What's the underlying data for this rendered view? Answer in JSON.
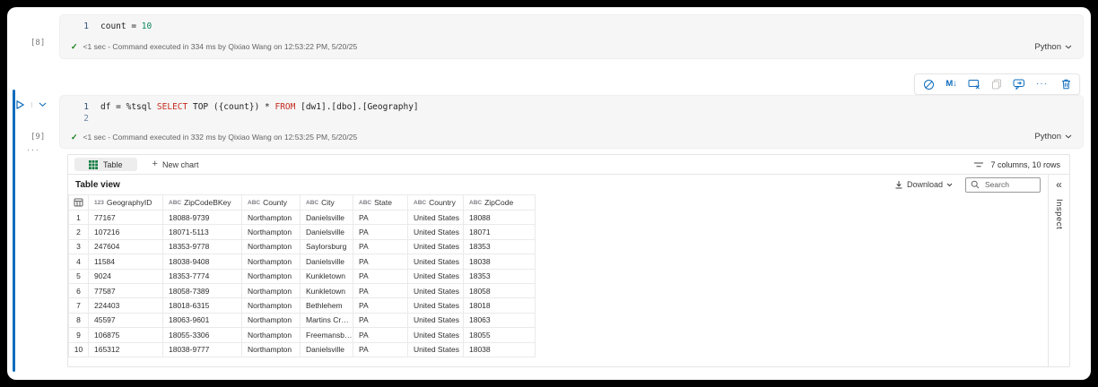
{
  "colors": {
    "accent_blue": "#0f6cbd",
    "success_green": "#0e7a0e",
    "keyword_red": "#c42b1c",
    "number_green": "#098658",
    "table_icon_green": "#107c41"
  },
  "glyphs": {
    "check": "✓",
    "markdown": "M↓",
    "more_menu": "···",
    "cell_more": "···",
    "plus": "+",
    "collapse": "«"
  },
  "cell1": {
    "exec_count": "[8]",
    "line1_no": "1",
    "code_pre": "count = ",
    "code_num": "10",
    "status": "<1 sec - Command executed in 334 ms by Qixiao Wang on 12:53:22 PM, 5/20/25",
    "kernel": "Python"
  },
  "cell2": {
    "exec_count": "[9]",
    "line1_no": "1",
    "line2_no": "2",
    "code": {
      "pre": "df = %tsql ",
      "kw1": "SELECT",
      "mid": " TOP ({count}) * ",
      "kw2": "FROM",
      "post": " [dw1].[dbo].[Geography]"
    },
    "status": "<1 sec - Command executed in 332 ms by Qixiao Wang on 12:53:25 PM, 5/20/25",
    "kernel": "Python"
  },
  "output": {
    "tabs": {
      "table_label": "Table",
      "new_chart_label": "New chart"
    },
    "summary": "7 columns, 10 rows",
    "view_title": "Table view",
    "download_label": "Download",
    "search_placeholder": "Search",
    "inspect_label": "Inspect",
    "table": {
      "columns": [
        {
          "type": "123",
          "name": "GeographyID"
        },
        {
          "type": "ABC",
          "name": "ZipCodeBKey"
        },
        {
          "type": "ABC",
          "name": "County"
        },
        {
          "type": "ABC",
          "name": "City"
        },
        {
          "type": "ABC",
          "name": "State"
        },
        {
          "type": "ABC",
          "name": "Country"
        },
        {
          "type": "ABC",
          "name": "ZipCode"
        }
      ],
      "rows": [
        {
          "n": "1",
          "cells": [
            "77167",
            "18088-9739",
            "Northampton",
            "Danielsville",
            "PA",
            "United States",
            "18088"
          ]
        },
        {
          "n": "2",
          "cells": [
            "107216",
            "18071-5113",
            "Northampton",
            "Danielsville",
            "PA",
            "United States",
            "18071"
          ]
        },
        {
          "n": "3",
          "cells": [
            "247604",
            "18353-9778",
            "Northampton",
            "Saylorsburg",
            "PA",
            "United States",
            "18353"
          ]
        },
        {
          "n": "4",
          "cells": [
            "11584",
            "18038-9408",
            "Northampton",
            "Danielsville",
            "PA",
            "United States",
            "18038"
          ]
        },
        {
          "n": "5",
          "cells": [
            "9024",
            "18353-7774",
            "Northampton",
            "Kunkletown",
            "PA",
            "United States",
            "18353"
          ]
        },
        {
          "n": "6",
          "cells": [
            "77587",
            "18058-7389",
            "Northampton",
            "Kunkletown",
            "PA",
            "United States",
            "18058"
          ]
        },
        {
          "n": "7",
          "cells": [
            "224403",
            "18018-6315",
            "Northampton",
            "Bethlehem",
            "PA",
            "United States",
            "18018"
          ]
        },
        {
          "n": "8",
          "cells": [
            "45597",
            "18063-9601",
            "Northampton",
            "Martins Cr…",
            "PA",
            "United States",
            "18063"
          ]
        },
        {
          "n": "9",
          "cells": [
            "106875",
            "18055-3306",
            "Northampton",
            "Freemansb…",
            "PA",
            "United States",
            "18055"
          ]
        },
        {
          "n": "10",
          "cells": [
            "165312",
            "18038-9777",
            "Northampton",
            "Danielsville",
            "PA",
            "United States",
            "18038"
          ]
        }
      ]
    }
  }
}
